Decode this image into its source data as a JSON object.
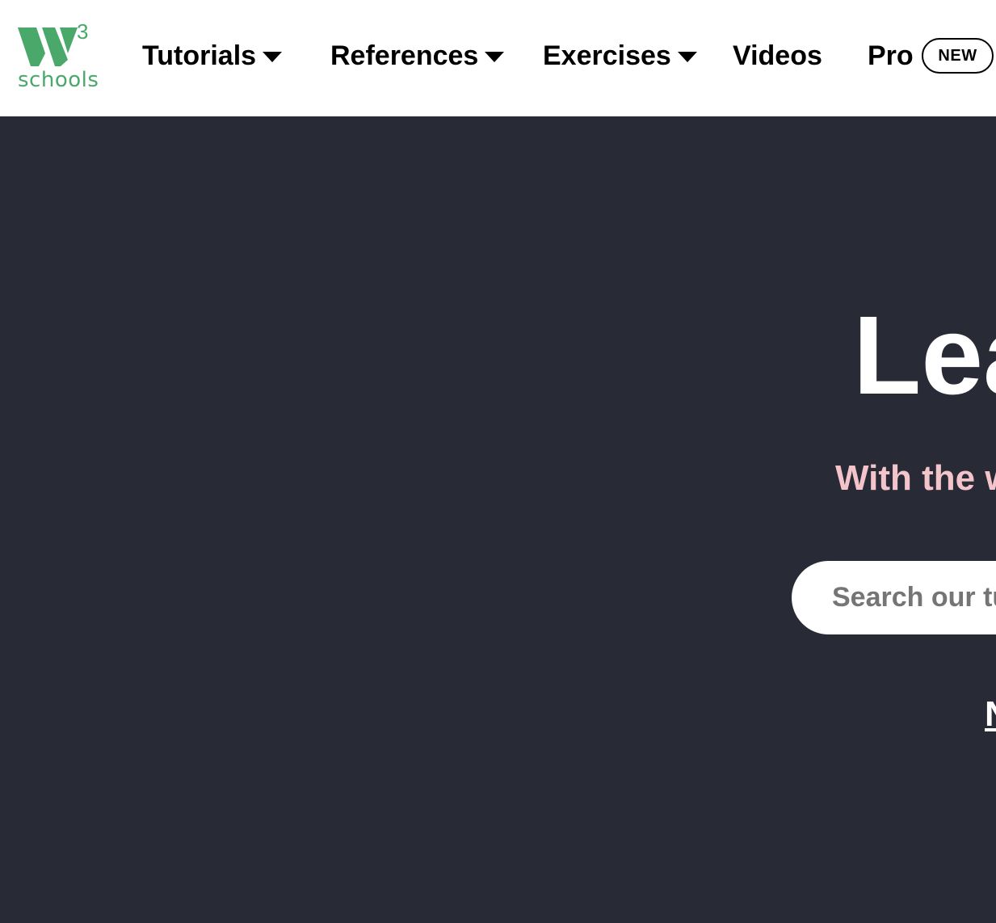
{
  "logo": {
    "superscript": "3",
    "word": "schools",
    "color": "#4aa86b"
  },
  "nav": {
    "tutorials": {
      "label": "Tutorials",
      "icon": "caret-down-icon"
    },
    "references": {
      "label": "References",
      "icon": "caret-down-icon"
    },
    "exercises": {
      "label": "Exercises",
      "icon": "caret-down-icon"
    },
    "videos": {
      "label": "Videos"
    },
    "pro": {
      "label": "Pro",
      "badge": "NEW"
    }
  },
  "hero": {
    "title": "Lea",
    "subtitle": "With the w",
    "search": {
      "placeholder": "Search our tut"
    },
    "link": "N"
  },
  "colors": {
    "nav_background": "#ffffff",
    "hero_background": "#282a35",
    "subtitle": "#f3c5cb",
    "brand_green": "#4aa86b"
  }
}
